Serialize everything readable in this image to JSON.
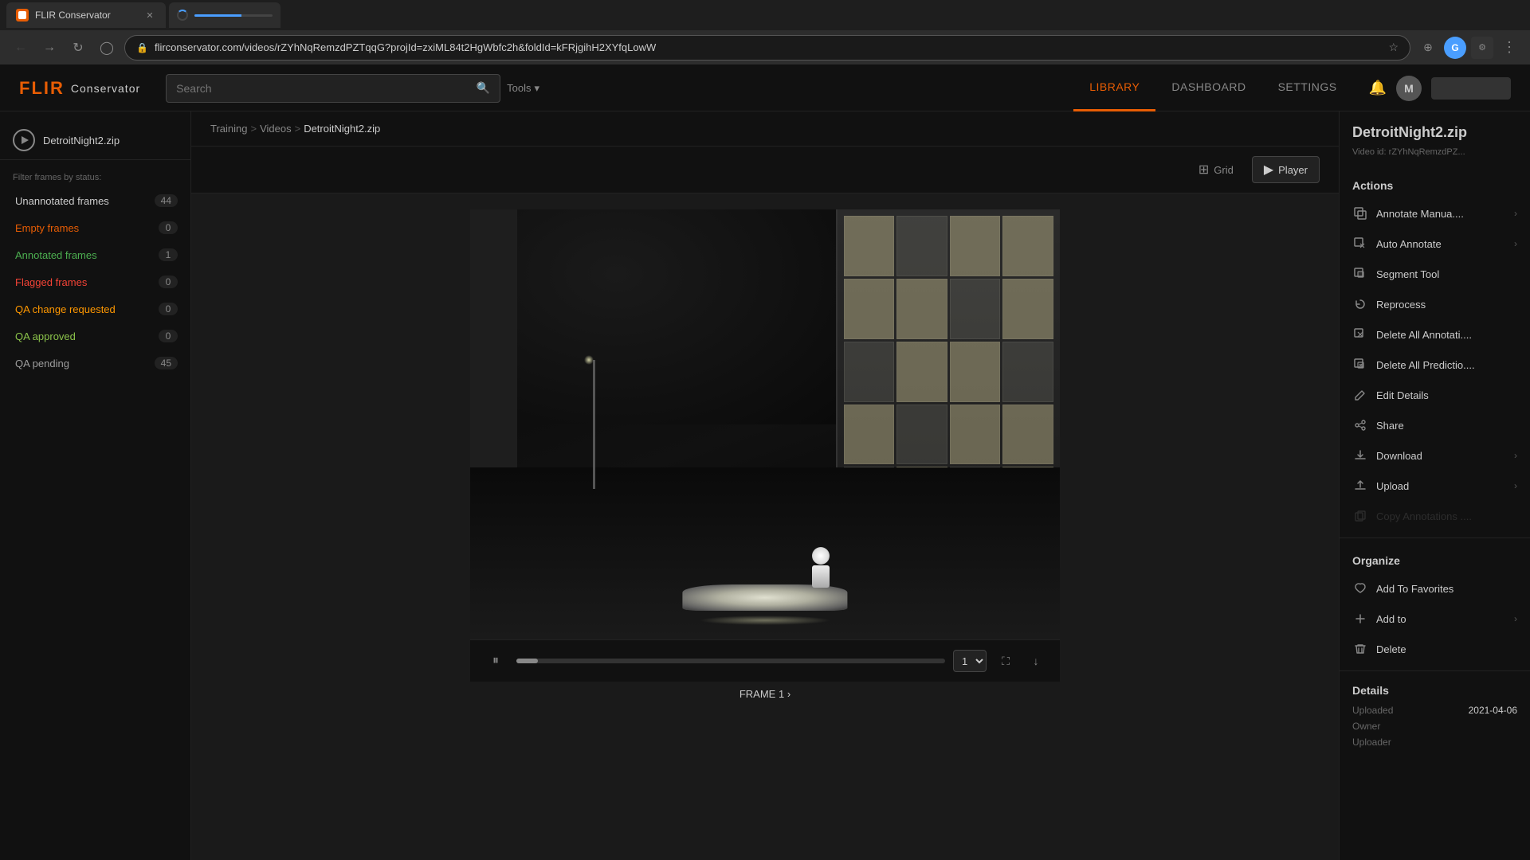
{
  "browser": {
    "tab_title": "FLIR Conservator",
    "tab_favicon": "F",
    "url": "flirconservator.com/videos/rZYhNqRemzdPZTqqG?projId=zxiML84t2HgWbfc2h&foldId=kFRjgihH2XYfqLowW",
    "loading_tab_text": ""
  },
  "header": {
    "logo_flir": "FLIR",
    "logo_conservator": "Conservator",
    "search_placeholder": "Search",
    "tools_label": "Tools",
    "nav_items": [
      {
        "label": "LIBRARY",
        "active": true
      },
      {
        "label": "DASHBOARD",
        "active": false
      },
      {
        "label": "SETTINGS",
        "active": false
      }
    ],
    "user_initial": "M"
  },
  "sidebar": {
    "video_name": "DetroitNight2.zip",
    "filter_label": "Filter frames by status:",
    "filters": [
      {
        "label": "Unannotated frames",
        "count": "44",
        "color": "unannotated"
      },
      {
        "label": "Empty frames",
        "count": "0",
        "color": "empty"
      },
      {
        "label": "Annotated frames",
        "count": "1",
        "color": "annotated"
      },
      {
        "label": "Flagged frames",
        "count": "0",
        "color": "flagged"
      },
      {
        "label": "QA change requested",
        "count": "0",
        "color": "qa-change"
      },
      {
        "label": "QA approved",
        "count": "0",
        "color": "qa-approved"
      },
      {
        "label": "QA pending",
        "count": "45",
        "color": "qa-pending"
      }
    ]
  },
  "breadcrumb": {
    "items": [
      "Training",
      "Videos",
      "DetroitNight2.zip"
    ],
    "separators": [
      ">",
      ">"
    ]
  },
  "view_controls": {
    "grid_label": "Grid",
    "player_label": "Player"
  },
  "player": {
    "frame_label": "FRAME 1",
    "frame_arrow": "›"
  },
  "right_panel": {
    "title": "DetroitNight2.zip",
    "video_id": "Video id: rZYhNqRemzdPZ...",
    "sections": {
      "actions": {
        "title": "Actions",
        "items": [
          {
            "label": "Annotate Manua....",
            "icon": "annotate",
            "has_arrow": true,
            "disabled": false
          },
          {
            "label": "Auto Annotate",
            "icon": "auto",
            "has_arrow": true,
            "disabled": false
          },
          {
            "label": "Segment Tool",
            "icon": "segment",
            "has_arrow": false,
            "disabled": false
          },
          {
            "label": "Reprocess",
            "icon": "reprocess",
            "has_arrow": false,
            "disabled": false
          },
          {
            "label": "Delete All Annotati....",
            "icon": "delete-annot",
            "has_arrow": false,
            "disabled": false
          },
          {
            "label": "Delete All Predictio....",
            "icon": "delete-pred",
            "has_arrow": false,
            "disabled": false
          },
          {
            "label": "Edit Details",
            "icon": "edit",
            "has_arrow": false,
            "disabled": false
          },
          {
            "label": "Share",
            "icon": "share",
            "has_arrow": false,
            "disabled": false
          },
          {
            "label": "Download",
            "icon": "download",
            "has_arrow": true,
            "disabled": false
          },
          {
            "label": "Upload",
            "icon": "upload",
            "has_arrow": true,
            "disabled": false
          },
          {
            "label": "Copy Annotations ....",
            "icon": "copy",
            "has_arrow": false,
            "disabled": true
          }
        ]
      },
      "organize": {
        "title": "Organize",
        "items": [
          {
            "label": "Add To Favorites",
            "icon": "favorite",
            "has_arrow": false,
            "disabled": false
          },
          {
            "label": "Add to",
            "icon": "add",
            "has_arrow": true,
            "disabled": false
          },
          {
            "label": "Delete",
            "icon": "delete",
            "has_arrow": false,
            "disabled": false
          }
        ]
      }
    },
    "details": {
      "title": "Details",
      "rows": [
        {
          "key": "Uploaded",
          "value": "2021-04-06"
        },
        {
          "key": "Owner",
          "value": ""
        },
        {
          "key": "Uploader",
          "value": ""
        }
      ]
    }
  }
}
